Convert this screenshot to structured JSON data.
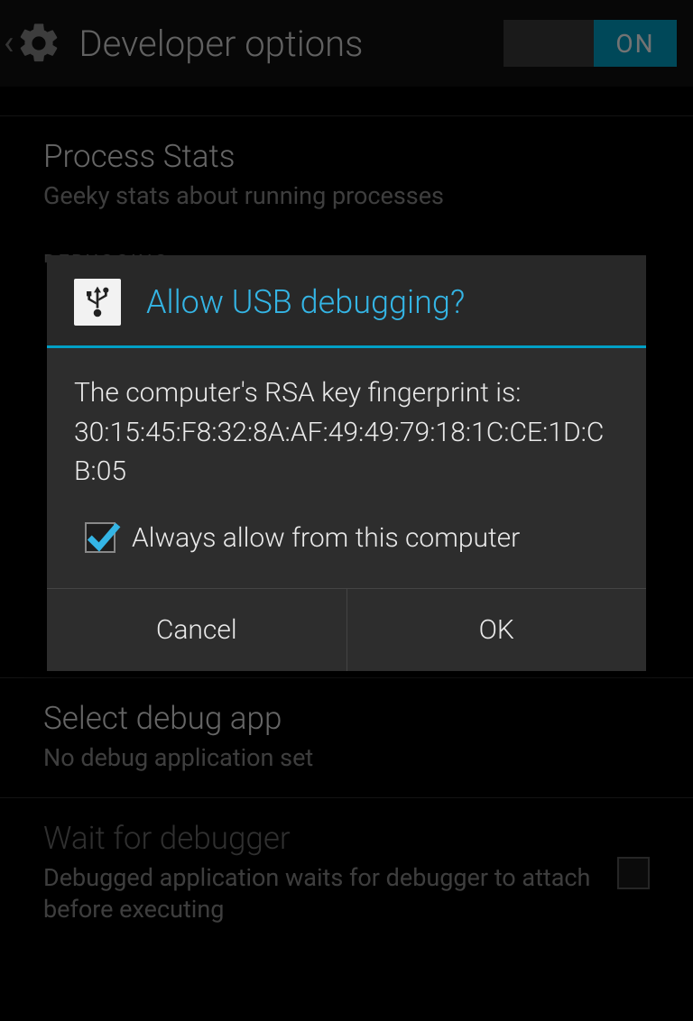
{
  "header": {
    "title": "Developer options",
    "toggle_state": "ON"
  },
  "list": {
    "process_stats": {
      "title": "Process Stats",
      "sub": "Geeky stats about running processes"
    },
    "debugging_section": "DEBUGGING",
    "select_debug": {
      "title": "Select debug app",
      "sub": "No debug application set"
    },
    "wait_debugger": {
      "title": "Wait for debugger",
      "sub": "Debugged application waits for debugger to attach before executing"
    }
  },
  "dialog": {
    "title": "Allow USB debugging?",
    "body_line1": "The computer's RSA key fingerprint is:",
    "body_line2": "30:15:45:F8:32:8A:AF:49:49:79:18:1C:CE:1D:CB:05",
    "checkbox_label": "Always allow from this computer",
    "cancel": "Cancel",
    "ok": "OK"
  }
}
